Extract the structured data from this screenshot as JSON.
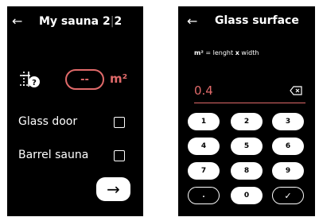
{
  "left": {
    "title_main": "My sauna 2",
    "title_sep": "|",
    "title_total": "2",
    "back_icon": "arrow-left-icon",
    "area_icon": "area-unknown-icon",
    "area_value": "--",
    "area_unit": "m²",
    "options": [
      {
        "label": "Glass door",
        "checked": false
      },
      {
        "label": "Barrel sauna",
        "checked": false
      }
    ],
    "next_icon": "arrow-right-icon",
    "next_glyph": "→",
    "accent": "#e06a6a"
  },
  "right": {
    "title": "Glass surface",
    "back_icon": "arrow-left-icon",
    "formula_unit": "m²",
    "formula_eq": " = lenght ",
    "formula_x": "x",
    "formula_rest": " width",
    "value": "0.4",
    "keys": [
      "1",
      "2",
      "3",
      "4",
      "5",
      "6",
      "7",
      "8",
      "9",
      ".",
      "0",
      "✓"
    ]
  }
}
